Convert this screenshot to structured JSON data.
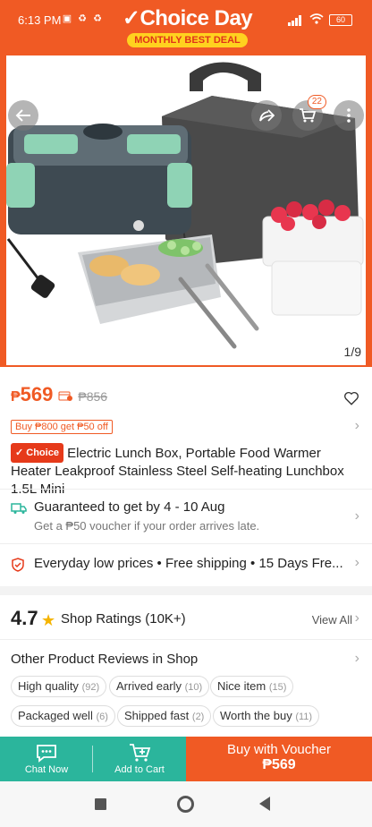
{
  "status_bar": {
    "time": "6:13 PM",
    "battery": "60"
  },
  "header": {
    "brand_title": "Choice Day",
    "brand_check": "✓",
    "brand_sub": "MONTHLY BEST DEAL"
  },
  "top_actions": {
    "cart_count": "22"
  },
  "gallery": {
    "counter": "1/9"
  },
  "price": {
    "currency": "₱",
    "current": "569",
    "original": "₱856"
  },
  "voucher": {
    "label": "Buy ₱800 get ₱50 off"
  },
  "product": {
    "badge": "✓ Choice",
    "title": "Electric Lunch Box, Portable Food Warmer Heater Leakproof Stainless Steel Self-heating Lunchbox 1.5L Mini"
  },
  "shipping": {
    "title": "Guaranteed to get by 4 - 10 Aug",
    "subtitle": "Get a ₱50 voucher if your order arrives late."
  },
  "perks": {
    "text": "Everyday low prices  •  Free shipping  •  15 Days Fre..."
  },
  "ratings": {
    "score": "4.7",
    "label": "Shop Ratings",
    "count": "(10K+)",
    "view_all": "View All"
  },
  "reviews": {
    "title": "Other Product Reviews in Shop",
    "tags": [
      {
        "label": "High quality",
        "count": "(92)"
      },
      {
        "label": "Arrived early",
        "count": "(10)"
      },
      {
        "label": "Nice item",
        "count": "(15)"
      },
      {
        "label": "Packaged well",
        "count": "(6)"
      },
      {
        "label": "Shipped fast",
        "count": "(2)"
      },
      {
        "label": "Worth the buy",
        "count": "(11)"
      }
    ]
  },
  "bottom_bar": {
    "chat_label": "Chat Now",
    "cart_label": "Add to Cart",
    "buy_label": "Buy with Voucher",
    "buy_price": "₱569"
  },
  "colors": {
    "accent": "#f05a24",
    "teal": "#2bb59c",
    "star": "#f5b400"
  }
}
